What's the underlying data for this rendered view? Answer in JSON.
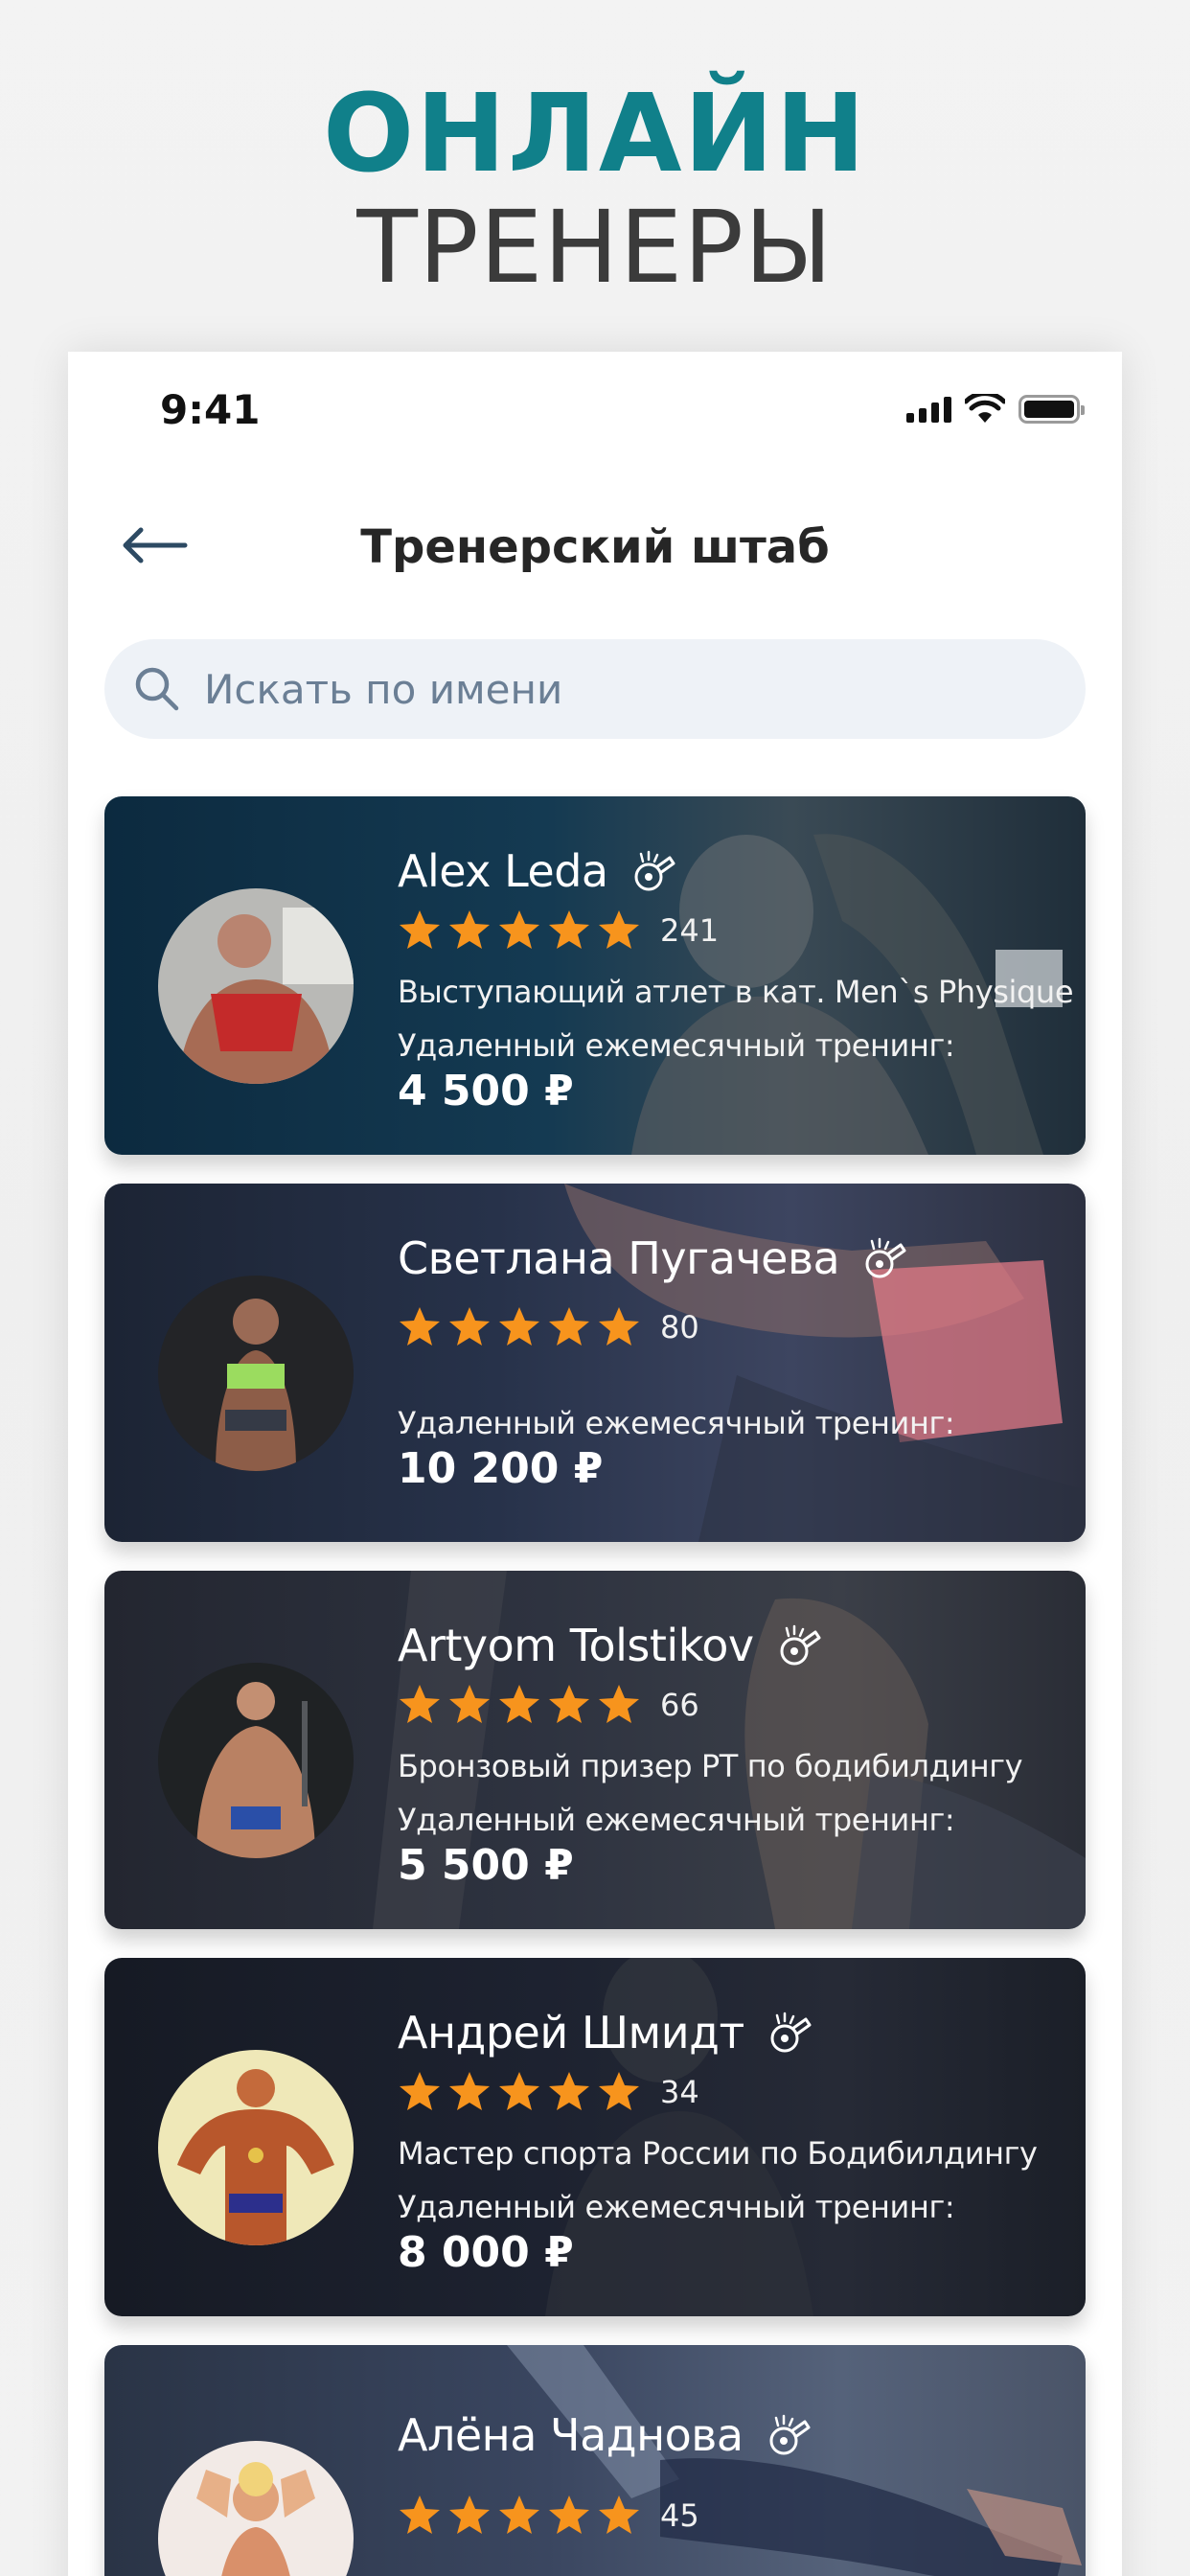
{
  "hero": {
    "line1": "ОНЛАЙН",
    "line2": "ТРЕНЕРЫ"
  },
  "status_bar": {
    "time": "9:41"
  },
  "nav": {
    "title": "Тренерский штаб",
    "back_icon": "arrow-left-icon"
  },
  "search": {
    "placeholder": "Искать по имени",
    "value": "",
    "icon": "search-icon"
  },
  "colors": {
    "hero_accent": "#10808a",
    "hero_text": "#3b3b3b",
    "star": "#f7941d",
    "search_bg": "#eef2f7"
  },
  "trainers": [
    {
      "name": "Alex Leda",
      "rating_stars": 5,
      "reviews": "241",
      "achievement": "Выступающий атлет в кат. Men`s Physique",
      "price_label": "Удаленный ежемесячный тренинг:",
      "price": "4 500 ₽"
    },
    {
      "name": "Светлана Пугачева",
      "rating_stars": 5,
      "reviews": "80",
      "achievement": "",
      "price_label": "Удаленный ежемесячный тренинг:",
      "price": "10 200 ₽"
    },
    {
      "name": "Artyom Tolstikov",
      "rating_stars": 5,
      "reviews": "66",
      "achievement": "Бронзовый призер РТ по бодибилдингу",
      "price_label": "Удаленный ежемесячный тренинг:",
      "price": "5 500 ₽"
    },
    {
      "name": "Андрей Шмидт",
      "rating_stars": 5,
      "reviews": "34",
      "achievement": "Мастер спорта России по Бодибилдингу",
      "price_label": "Удаленный ежемесячный тренинг:",
      "price": "8 000 ₽"
    },
    {
      "name": "Алёна Чаднова",
      "rating_stars": 5,
      "reviews": "45",
      "achievement": "",
      "price_label": "",
      "price": ""
    }
  ]
}
